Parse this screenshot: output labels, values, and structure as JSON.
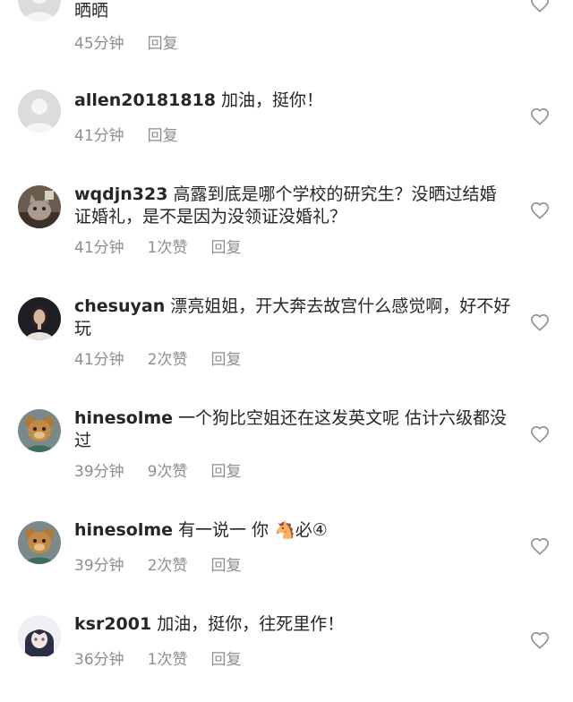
{
  "comments": [
    {
      "username": "",
      "text": "晒晒",
      "time": "45分钟",
      "likes": "",
      "reply": "回复",
      "avatar": "default-avatar"
    },
    {
      "username": "allen20181818",
      "text": "加油，挺你！",
      "time": "41分钟",
      "likes": "",
      "reply": "回复",
      "avatar": "default-avatar"
    },
    {
      "username": "wqdjn323",
      "text": "高露到底是哪个学校的研究生？没晒过结婚证婚礼，是不是因为没领证没婚礼？",
      "time": "41分钟",
      "likes": "1次赞",
      "reply": "回复",
      "avatar": "cat-avatar"
    },
    {
      "username": "chesuyan",
      "text": "漂亮姐姐，开大奔去故宫什么感觉啊，好不好玩",
      "time": "41分钟",
      "likes": "2次赞",
      "reply": "回复",
      "avatar": "woman-avatar"
    },
    {
      "username": "hinesolme",
      "text": "一个狗比空姐还在这发英文呢  估计六级都没过",
      "time": "39分钟",
      "likes": "9次赞",
      "reply": "回复",
      "avatar": "bear-avatar"
    },
    {
      "username": "hinesolme",
      "text": "有一说一  你 🐴必④",
      "time": "39分钟",
      "likes": "2次赞",
      "reply": "回复",
      "avatar": "bear-avatar"
    },
    {
      "username": "ksr2001",
      "text": "加油，挺你，往死里作！",
      "time": "36分钟",
      "likes": "1次赞",
      "reply": "回复",
      "avatar": "anime-avatar"
    }
  ],
  "colors": {
    "text": "#262626",
    "meta": "#8e8e8e",
    "heart": "#8e8e8e",
    "background": "#ffffff"
  }
}
